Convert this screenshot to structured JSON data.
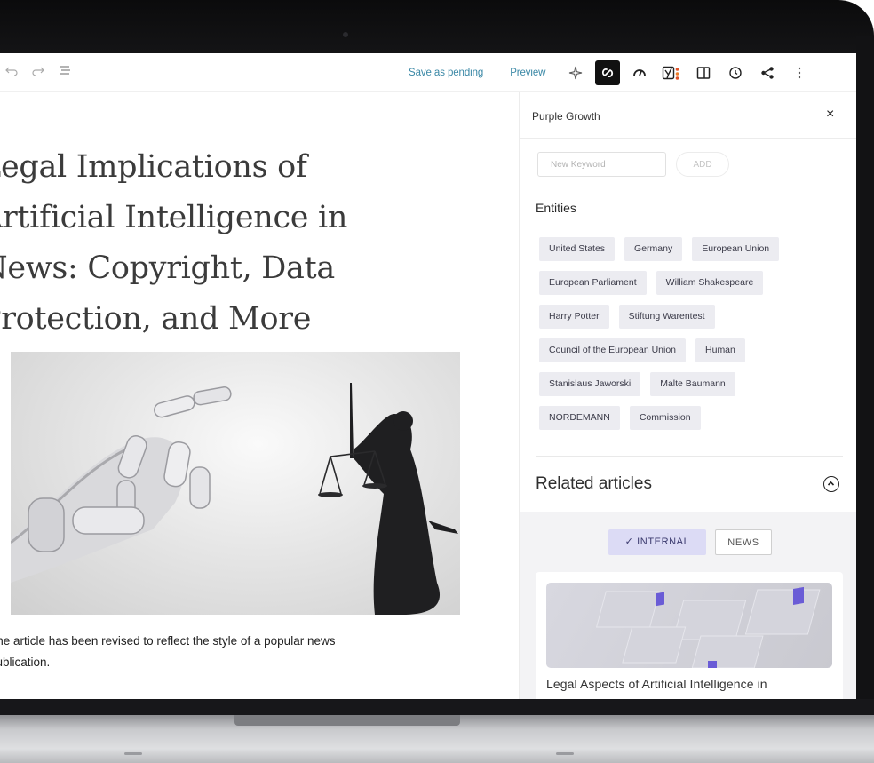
{
  "toolbar": {
    "save_label": "Save as pending",
    "preview_label": "Preview"
  },
  "editor": {
    "title_lines": [
      "Legal Implications of",
      "Artificial Intelligence in",
      "News: Copyright, Data",
      "Protection, and More"
    ],
    "caption_lines": [
      "The article has been revised to reflect the style of a popular news",
      "publication."
    ]
  },
  "sidebar": {
    "title": "Purple Growth",
    "close_glyph": "×",
    "keyword_placeholder": "New Keyword",
    "add_label": "ADD",
    "entities_title": "Entities",
    "entity_rows": [
      [
        "United States",
        "Germany",
        "European Union"
      ],
      [
        "European Parliament",
        "William Shakespeare"
      ],
      [
        "Harry Potter",
        "Stiftung Warentest"
      ],
      [
        "Council of the European Union",
        "Human"
      ],
      [
        "Stanislaus Jaworski",
        "Malte Baumann"
      ],
      [
        "NORDEMANN",
        "Commission"
      ]
    ],
    "related_title": "Related articles",
    "tab_internal": "✓  INTERNAL",
    "tab_news": "NEWS",
    "card_title": "Legal Aspects of Artificial Intelligence in"
  },
  "icons": [
    "undo-icon",
    "redo-icon",
    "list-view-icon",
    "sparkle-icon",
    "link-icon",
    "gauge-icon",
    "yoast-icon",
    "sidebar-toggle-icon",
    "clock-icon",
    "share-icon",
    "more-options-icon",
    "close-icon",
    "chevron-up-icon"
  ],
  "colors": {
    "link": "#3a88a6",
    "chip_bg": "#ececf1",
    "internal_tab_bg": "#dcdbf5",
    "yoast_traffic": "#e05a2b"
  }
}
